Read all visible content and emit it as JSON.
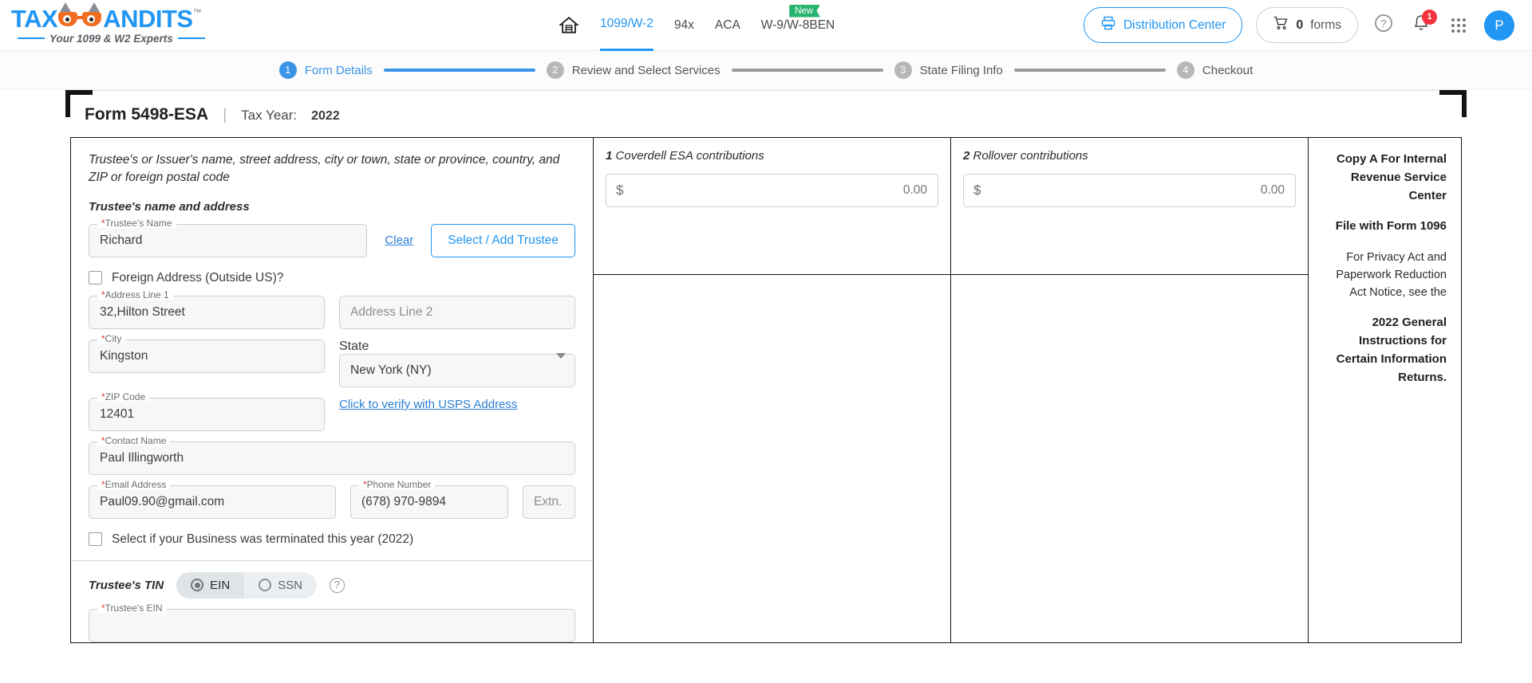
{
  "brand": {
    "name_part1": "TAX",
    "name_part2": "ANDITS",
    "tm": "™",
    "tagline": "Your 1099 & W2 Experts"
  },
  "nav": {
    "home_icon": "home-icon",
    "links": [
      {
        "label": "1099/W-2",
        "active": true,
        "badge": null
      },
      {
        "label": "94x",
        "active": false,
        "badge": null
      },
      {
        "label": "ACA",
        "active": false,
        "badge": null
      },
      {
        "label": "W-9/W-8BEN",
        "active": false,
        "badge": "New"
      }
    ],
    "distribution_center": "Distribution Center",
    "cart_count": "0",
    "cart_unit": "forms",
    "help_icon": "question-mark-icon",
    "notification_count": "1",
    "apps_icon": "apps-grid-icon",
    "avatar_initial": "P",
    "accent_color": "#2196f3",
    "badge_color": "#27b46e",
    "alert_color": "#f4323c"
  },
  "stepper": {
    "steps": [
      {
        "num": "1",
        "label": "Form Details",
        "state": "active"
      },
      {
        "num": "2",
        "label": "Review and Select Services",
        "state": "inactive"
      },
      {
        "num": "3",
        "label": "State Filing Info",
        "state": "inactive"
      },
      {
        "num": "4",
        "label": "Checkout",
        "state": "inactive"
      }
    ]
  },
  "form_header": {
    "title": "Form 5498-ESA",
    "separator": "|",
    "tax_year_label": "Tax Year:",
    "tax_year_value": "2022"
  },
  "left_panel": {
    "header_text": "Trustee's or Issuer's name, street address, city or town, state or province, country, and ZIP or foreign postal code",
    "section_label": "Trustee's name and address",
    "trustee_name": {
      "legend": "Trustee's Name",
      "required": true,
      "value": "Richard"
    },
    "clear_link": "Clear",
    "select_add_trustee": "Select / Add Trustee",
    "foreign_address": {
      "label": "Foreign Address (Outside US)?",
      "checked": false
    },
    "address_line_1": {
      "legend": "Address Line 1",
      "required": true,
      "value": "32,Hilton Street"
    },
    "address_line_2": {
      "legend": "",
      "required": false,
      "value": "",
      "placeholder": "Address Line 2"
    },
    "city": {
      "legend": "City",
      "required": true,
      "value": "Kingston"
    },
    "state": {
      "legend": "State",
      "required": false,
      "value": "New York (NY)"
    },
    "zip_code": {
      "legend": "ZIP Code",
      "required": true,
      "value": "12401"
    },
    "usps_link": "Click to verify with USPS Address",
    "contact_name": {
      "legend": "Contact Name",
      "required": true,
      "value": "Paul Illingworth"
    },
    "email_address": {
      "legend": "Email Address",
      "required": true,
      "value": "Paul09.90@gmail.com"
    },
    "phone_number": {
      "legend": "Phone Number",
      "required": true,
      "value": "(678) 970-9894"
    },
    "extension": {
      "legend": "",
      "required": false,
      "value": "",
      "placeholder": "Extn."
    },
    "business_terminated": {
      "label": "Select if your Business was terminated this year (2022)",
      "checked": false
    },
    "tin": {
      "title": "Trustee's TIN",
      "option_ein": "EIN",
      "option_ssn": "SSN",
      "selected": "EIN",
      "help_icon": "question-mark-icon",
      "field_legend": "Trustee's EIN"
    }
  },
  "boxes": [
    {
      "number": "1",
      "title": "Coverdell ESA contributions",
      "dollar": "$",
      "value": "",
      "placeholder": "0.00"
    },
    {
      "number": "2",
      "title": "Rollover contributions",
      "dollar": "$",
      "value": "",
      "placeholder": "0.00"
    }
  ],
  "copy_a": {
    "line1": "Copy A For Internal Revenue Service Center",
    "line2": "File with Form 1096",
    "line3": "For Privacy Act and Paperwork Reduction Act Notice, see the",
    "line4": "2022 General Instructions for Certain Information Returns."
  }
}
